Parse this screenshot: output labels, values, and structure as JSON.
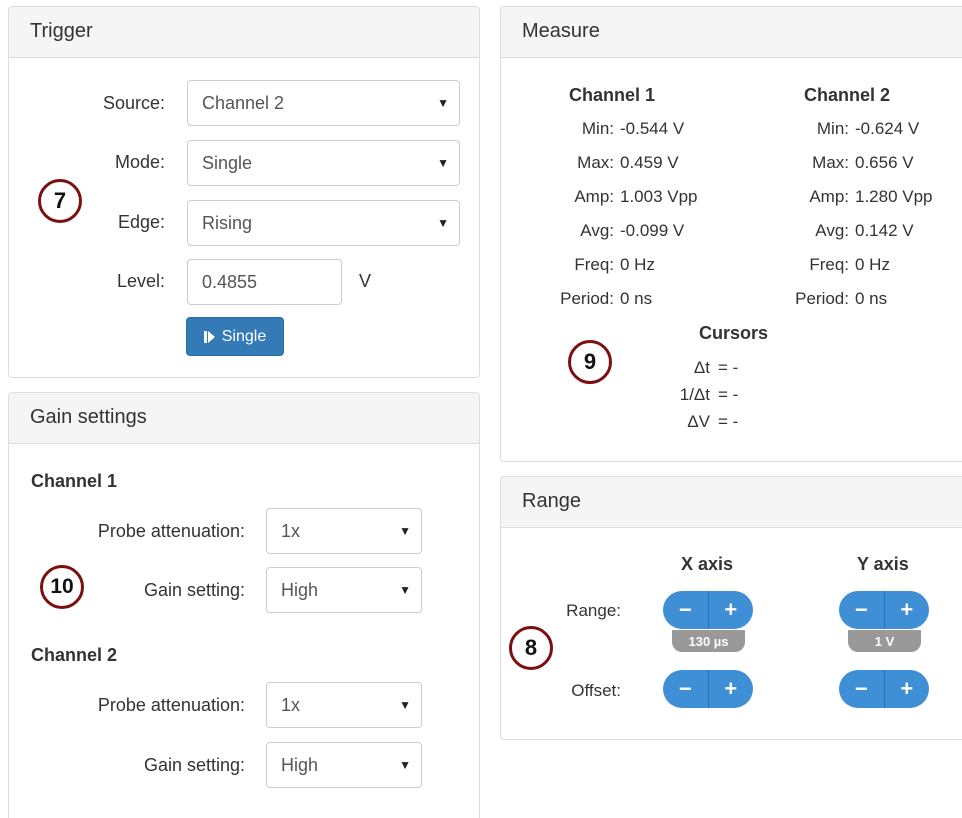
{
  "trigger": {
    "title": "Trigger",
    "source_label": "Source:",
    "source_value": "Channel 2",
    "mode_label": "Mode:",
    "mode_value": "Single",
    "edge_label": "Edge:",
    "edge_value": "Rising",
    "level_label": "Level:",
    "level_value": "0.4855",
    "level_unit": "V",
    "single_button": "Single",
    "callout": "7"
  },
  "measure": {
    "title": "Measure",
    "channels": [
      {
        "name": "Channel 1",
        "rows": [
          {
            "label": "Min:",
            "value": "-0.544 V"
          },
          {
            "label": "Max:",
            "value": "0.459 V"
          },
          {
            "label": "Amp:",
            "value": "1.003 Vpp"
          },
          {
            "label": "Avg:",
            "value": "-0.099 V"
          },
          {
            "label": "Freq:",
            "value": "0 Hz"
          },
          {
            "label": "Period:",
            "value": "0 ns"
          }
        ]
      },
      {
        "name": "Channel 2",
        "rows": [
          {
            "label": "Min:",
            "value": "-0.624 V"
          },
          {
            "label": "Max:",
            "value": "0.656 V"
          },
          {
            "label": "Amp:",
            "value": "1.280 Vpp"
          },
          {
            "label": "Avg:",
            "value": "0.142 V"
          },
          {
            "label": "Freq:",
            "value": "0 Hz"
          },
          {
            "label": "Period:",
            "value": "0 ns"
          }
        ]
      }
    ],
    "cursors_title": "Cursors",
    "cursors": [
      {
        "label": "Δt",
        "value": "= -"
      },
      {
        "label": "1/Δt",
        "value": "= -"
      },
      {
        "label": "ΔV",
        "value": "= -"
      }
    ],
    "callout": "9"
  },
  "gain": {
    "title": "Gain settings",
    "channels": [
      {
        "name": "Channel 1",
        "probe_label": "Probe attenuation:",
        "probe_value": "1x",
        "gain_label": "Gain setting:",
        "gain_value": "High"
      },
      {
        "name": "Channel 2",
        "probe_label": "Probe attenuation:",
        "probe_value": "1x",
        "gain_label": "Gain setting:",
        "gain_value": "High"
      }
    ],
    "callout": "10"
  },
  "range": {
    "title": "Range",
    "x_axis": "X axis",
    "y_axis": "Y axis",
    "range_label": "Range:",
    "offset_label": "Offset:",
    "x_range_value": "130 µs",
    "y_range_value": "1 V",
    "minus": "−",
    "plus": "+",
    "callout": "8"
  },
  "icons": {
    "caret": "▼",
    "single_icon": "step-icon"
  },
  "colors": {
    "primary": "#337ab7",
    "pm_button": "#3e8fd6",
    "badge": "#999999",
    "callout_border": "#7a1010"
  }
}
